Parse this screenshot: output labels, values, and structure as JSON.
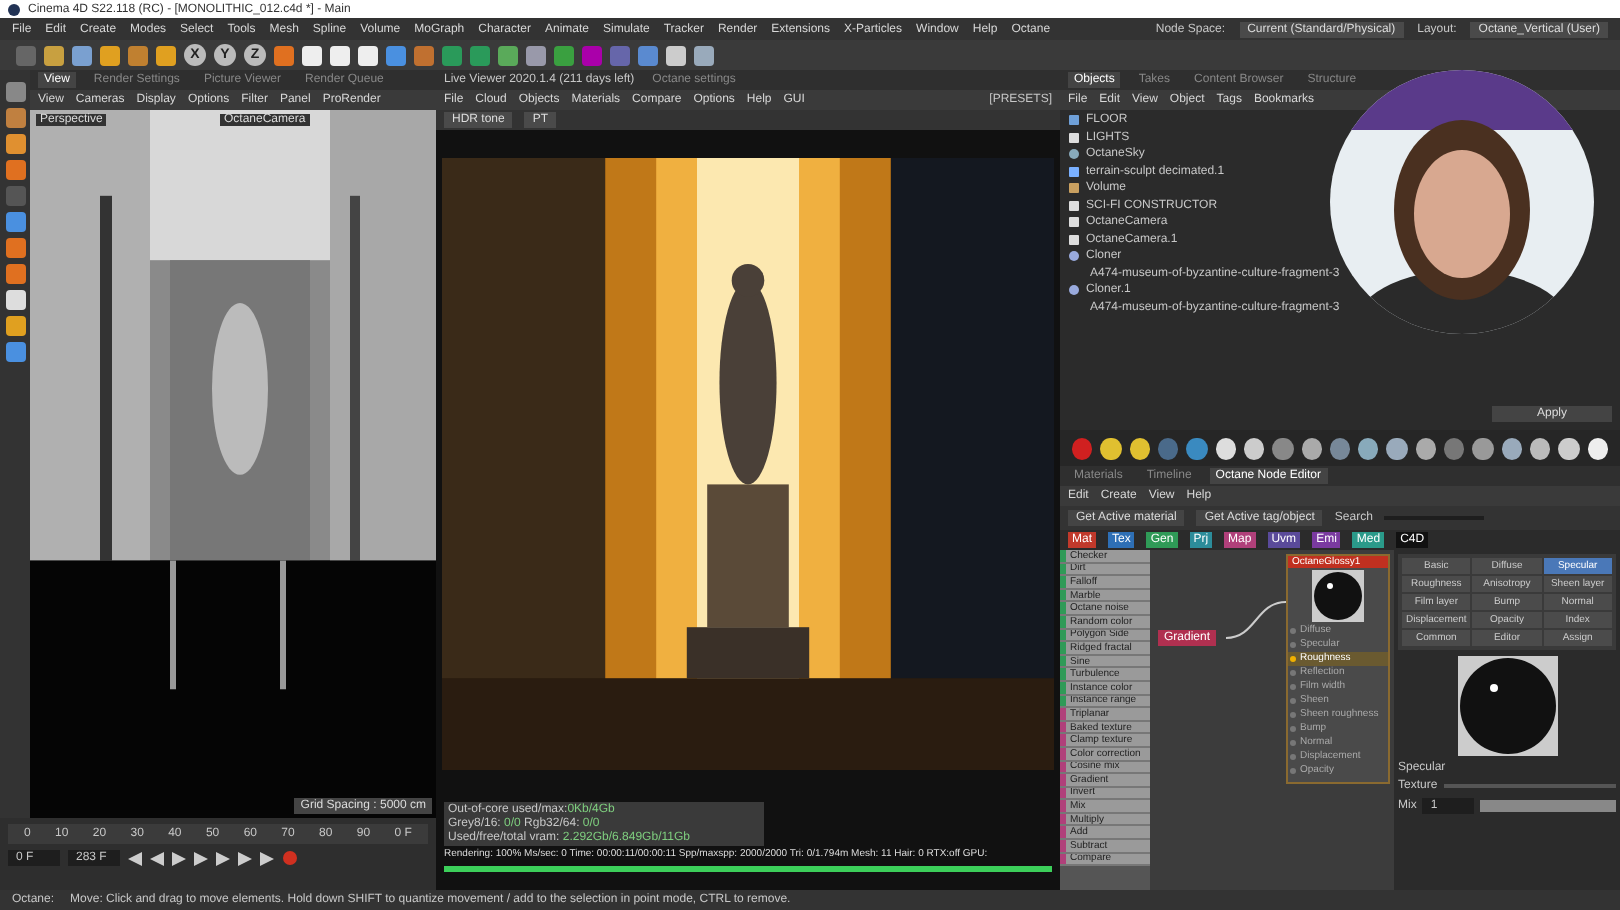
{
  "window": {
    "title": "Cinema 4D S22.118 (RC) - [MONOLITHIC_012.c4d *] - Main"
  },
  "menu": [
    "File",
    "Edit",
    "Create",
    "Modes",
    "Select",
    "Tools",
    "Mesh",
    "Spline",
    "Volume",
    "MoGraph",
    "Character",
    "Animate",
    "Simulate",
    "Tracker",
    "Render",
    "Extensions",
    "X-Particles",
    "Window",
    "Help",
    "Octane"
  ],
  "node_space": {
    "label": "Node Space:",
    "value": "Current (Standard/Physical)"
  },
  "layout": {
    "label": "Layout:",
    "value": "Octane_Vertical (User)"
  },
  "axes": [
    "X",
    "Y",
    "Z"
  ],
  "viewport": {
    "tabs": [
      {
        "label": "View",
        "selected": true
      },
      {
        "label": "Render Settings",
        "selected": false
      },
      {
        "label": "Picture Viewer",
        "selected": false
      },
      {
        "label": "Render Queue",
        "selected": false
      }
    ],
    "menu": [
      "View",
      "Cameras",
      "Display",
      "Options",
      "Filter",
      "Panel",
      "ProRender"
    ],
    "camera_label": "Perspective",
    "camera": "OctaneCamera",
    "grid_spacing": "Grid Spacing : 5000 cm"
  },
  "timeline": {
    "ticks": [
      "0",
      "10",
      "20",
      "30",
      "40",
      "50",
      "60",
      "70",
      "80",
      "90"
    ],
    "current": "0 F",
    "start": "0 F",
    "end": "283 F"
  },
  "live_viewer": {
    "title": "Live Viewer 2020.1.4 (211 days left)",
    "settings": "Octane settings",
    "menu": [
      "File",
      "Cloud",
      "Objects",
      "Materials",
      "Compare",
      "Options",
      "Help",
      "GUI"
    ],
    "presets": "[PRESETS]",
    "mode": "HDR tone",
    "channel": "PT"
  },
  "stats": [
    {
      "label": "Out-of-core used/max:",
      "value": "0Kb/4Gb"
    },
    {
      "label": "Grey8/16:",
      "value": "0/0"
    },
    {
      "label": "Rgb32/64:",
      "value": "0/0"
    },
    {
      "label": "Used/free/total vram:",
      "value": "2.292Gb/6.849Gb/11Gb"
    }
  ],
  "render_status": "Rendering: 100%  Ms/sec: 0  Time: 00:00:11/00:00:11  Spp/maxspp: 2000/2000  Tri: 0/1.794m  Mesh: 11  Hair: 0  RTX:off  GPU:",
  "render_progress": {
    "level": 1
  },
  "objects": {
    "tabs": [
      {
        "label": "Objects",
        "selected": true
      },
      {
        "label": "Takes",
        "selected": false
      },
      {
        "label": "Content Browser",
        "selected": false
      },
      {
        "label": "Structure",
        "selected": false
      }
    ],
    "menu": [
      "File",
      "Edit",
      "View",
      "Object",
      "Tags",
      "Bookmarks"
    ],
    "items": [
      {
        "name": "FLOOR",
        "kind": "folder"
      },
      {
        "name": "LIGHTS",
        "kind": "null"
      },
      {
        "name": "OctaneSky",
        "kind": "sky"
      },
      {
        "name": "terrain-sculpt decimated.1",
        "kind": "mesh"
      },
      {
        "name": "Volume",
        "kind": "volume"
      },
      {
        "name": "SCI-FI CONSTRUCTOR",
        "kind": "null"
      },
      {
        "name": "OctaneCamera",
        "kind": "camera"
      },
      {
        "name": "OctaneCamera.1",
        "kind": "camera"
      },
      {
        "name": "Cloner",
        "kind": "cloner",
        "children": [
          {
            "name": "A474-museum-of-byzantine-culture-fragment-3",
            "kind": "mesh"
          }
        ]
      },
      {
        "name": "Cloner.1",
        "kind": "cloner",
        "children": [
          {
            "name": "A474-museum-of-byzantine-culture-fragment-3",
            "kind": "mesh"
          }
        ]
      }
    ]
  },
  "apply": "Apply",
  "panel_tabs": [
    {
      "label": "Materials",
      "selected": false
    },
    {
      "label": "Timeline",
      "selected": false
    },
    {
      "label": "Octane Node Editor",
      "selected": true
    }
  ],
  "node_editor": {
    "menu": [
      "Edit",
      "Create",
      "View",
      "Help"
    ],
    "buttons": [
      "Get Active material",
      "Get Active tag/object"
    ],
    "search_label": "Search",
    "categories": [
      {
        "label": "Mat",
        "color": "#c0392b"
      },
      {
        "label": "Tex",
        "color": "#2e6fb5"
      },
      {
        "label": "Gen",
        "color": "#2f9a57"
      },
      {
        "label": "Prj",
        "color": "#2c8c9a"
      },
      {
        "label": "Map",
        "color": "#b0407a"
      },
      {
        "label": "Uvm",
        "color": "#5a4a9a"
      },
      {
        "label": "Emi",
        "color": "#7a3aa0"
      },
      {
        "label": "Med",
        "color": "#2a9a8a"
      },
      {
        "label": "C4D",
        "color": "#111111"
      }
    ],
    "list": [
      {
        "name": "Checker",
        "color": "#2f9a57"
      },
      {
        "name": "Dirt",
        "color": "#2f9a57"
      },
      {
        "name": "Falloff",
        "color": "#2f9a57"
      },
      {
        "name": "Marble",
        "color": "#2f9a57"
      },
      {
        "name": "Octane noise",
        "color": "#2f9a57"
      },
      {
        "name": "Random color",
        "color": "#2f9a57"
      },
      {
        "name": "Polygon Side",
        "color": "#2f9a57"
      },
      {
        "name": "Ridged fractal",
        "color": "#2f9a57"
      },
      {
        "name": "Sine",
        "color": "#2f9a57"
      },
      {
        "name": "Turbulence",
        "color": "#2f9a57"
      },
      {
        "name": "Instance color",
        "color": "#2f9a57"
      },
      {
        "name": "Instance range",
        "color": "#2f9a57"
      },
      {
        "name": "Triplanar",
        "color": "#b0407a"
      },
      {
        "name": "Baked texture",
        "color": "#b0407a"
      },
      {
        "name": "Clamp texture",
        "color": "#b0407a"
      },
      {
        "name": "Color correction",
        "color": "#b0407a"
      },
      {
        "name": "Cosine mix",
        "color": "#b0407a"
      },
      {
        "name": "Gradient",
        "color": "#b0407a"
      },
      {
        "name": "Invert",
        "color": "#b0407a"
      },
      {
        "name": "Mix",
        "color": "#b0407a"
      },
      {
        "name": "Multiply",
        "color": "#b0407a"
      },
      {
        "name": "Add",
        "color": "#b0407a"
      },
      {
        "name": "Subtract",
        "color": "#b0407a"
      },
      {
        "name": "Compare",
        "color": "#b0407a"
      }
    ],
    "source_node": "Gradient",
    "material_node": "OctaneGlossy1",
    "ports": [
      {
        "name": "Diffuse",
        "linked": false
      },
      {
        "name": "Specular",
        "linked": false
      },
      {
        "name": "Roughness",
        "linked": true
      },
      {
        "name": "Reflection",
        "linked": false
      },
      {
        "name": "Film width",
        "linked": false
      },
      {
        "name": "Sheen",
        "linked": false
      },
      {
        "name": "Sheen roughness",
        "linked": false
      },
      {
        "name": "Bump",
        "linked": false
      },
      {
        "name": "Normal",
        "linked": false
      },
      {
        "name": "Displacement",
        "linked": false
      },
      {
        "name": "Opacity",
        "linked": false
      }
    ],
    "channels": [
      {
        "label": "Basic",
        "selected": false
      },
      {
        "label": "Diffuse",
        "selected": false
      },
      {
        "label": "Specular",
        "selected": true
      },
      {
        "label": "Roughness",
        "selected": false
      },
      {
        "label": "Anisotropy",
        "selected": false
      },
      {
        "label": "Sheen layer",
        "selected": false
      },
      {
        "label": "Film layer",
        "selected": false
      },
      {
        "label": "Bump",
        "selected": false
      },
      {
        "label": "Normal",
        "selected": false
      },
      {
        "label": "Displacement",
        "selected": false
      },
      {
        "label": "Opacity",
        "selected": false
      },
      {
        "label": "Index",
        "selected": false
      },
      {
        "label": "Common",
        "selected": false
      },
      {
        "label": "Editor",
        "selected": false
      },
      {
        "label": "Assign",
        "selected": false
      }
    ],
    "preview_label": "Specular",
    "texture_label": "Texture",
    "mix_label": "Mix",
    "mix_value": "1",
    "mix_slider": {
      "level": 1
    }
  },
  "status": {
    "label": "Octane:",
    "message": "Move: Click and drag to move elements. Hold down SHIFT to quantize movement / add to the selection in point mode, CTRL to remove."
  }
}
